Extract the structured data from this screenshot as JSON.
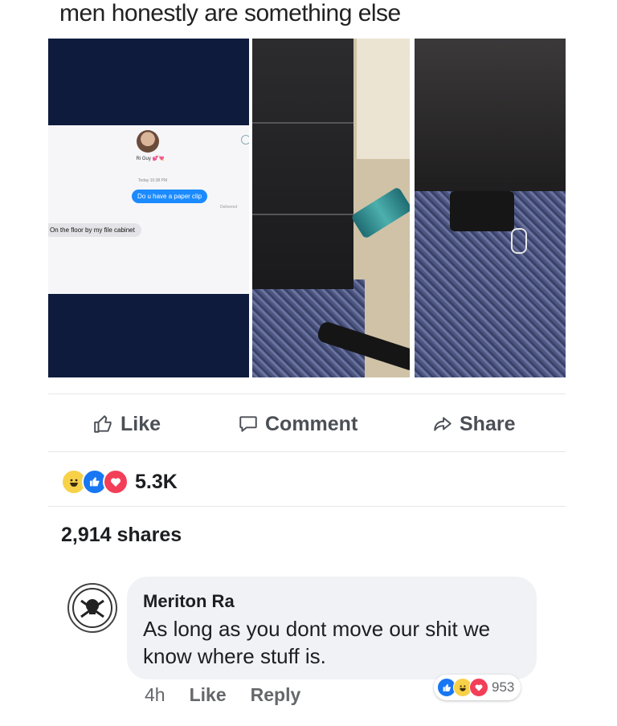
{
  "caption": "men honestly are something else",
  "post_image": {
    "contact_name": "Ri Guy 💕💘",
    "timestamp": "Today 10:38 PM",
    "sent_message": "Do u have a paper clip",
    "delivered": "Delivered",
    "reply_message": "On the floor by my file cabinet"
  },
  "actions": {
    "like": "Like",
    "comment": "Comment",
    "share": "Share"
  },
  "reactions": {
    "count": "5.3K",
    "types": [
      "haha",
      "like",
      "love"
    ]
  },
  "shares": "2,914 shares",
  "comment": {
    "author": "Meriton Ra",
    "text": "As long as you dont move our shit we know where stuff is.",
    "age": "4h",
    "like": "Like",
    "reply": "Reply",
    "reaction_count": "953",
    "reaction_types": [
      "like",
      "haha",
      "love"
    ]
  },
  "colors": {
    "facebook_blue": "#1877f2",
    "love_red": "#f33e58",
    "haha_yellow": "#f7d148",
    "action_gray": "#4b4f56",
    "imessage_blue": "#1b8bff"
  }
}
